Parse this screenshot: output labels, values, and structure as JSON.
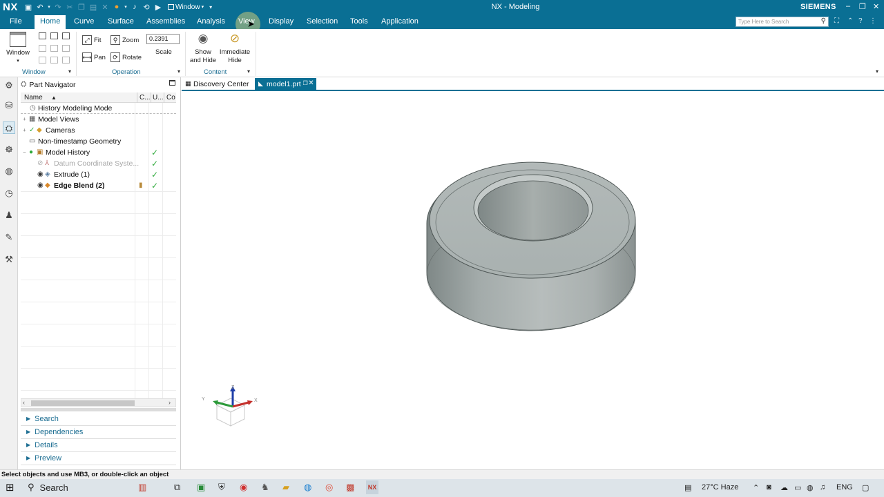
{
  "title_bar": {
    "logo": "NX",
    "window_dropdown": "Window",
    "app_title": "NX - Modeling",
    "brand": "SIEMENS"
  },
  "menu": {
    "file": "File",
    "tabs": [
      "Home",
      "Curve",
      "Surface",
      "Assemblies",
      "Analysis",
      "View",
      "Display",
      "Selection",
      "Tools",
      "Application"
    ],
    "active_tab": "Home",
    "search_placeholder": "Type Here to Search"
  },
  "ribbon": {
    "window_group": {
      "button": "Window",
      "label": "Window"
    },
    "operation_group": {
      "fit": "Fit",
      "zoom": "Zoom",
      "pan": "Pan",
      "rotate": "Rotate",
      "scale_value": "0.2391",
      "scale_label": "Scale",
      "label": "Operation"
    },
    "content_group": {
      "show_hide_1": "Show",
      "show_hide_2": "and Hide",
      "imm_hide_1": "Immediate",
      "imm_hide_2": "Hide",
      "label": "Content"
    }
  },
  "navigator": {
    "title": "Part Navigator",
    "columns": {
      "name": "Name",
      "c": "C...",
      "u": "U...",
      "co": "Co"
    },
    "rows": [
      {
        "label": "History Modeling Mode"
      },
      {
        "label": "Model Views"
      },
      {
        "label": "Cameras"
      },
      {
        "label": "Non-timestamp Geometry"
      },
      {
        "label": "Model History"
      },
      {
        "label": "Datum Coordinate Syste..."
      },
      {
        "label": "Extrude (1)"
      },
      {
        "label": "Edge Blend (2)"
      }
    ],
    "sections": [
      "Search",
      "Dependencies",
      "Details",
      "Preview"
    ]
  },
  "graphics_tabs": [
    "Discovery Center",
    "model1.prt"
  ],
  "triad": {
    "x": "X",
    "y": "Y",
    "z": "Z"
  },
  "status": "Select objects and use MB3, or double-click an object",
  "taskbar": {
    "search": "Search",
    "weather": "27°C  Haze",
    "lang": "ENG"
  },
  "colors": {
    "accent": "#0a6f94",
    "check": "#2eaa3b",
    "model_gray": "#a4acaa"
  }
}
